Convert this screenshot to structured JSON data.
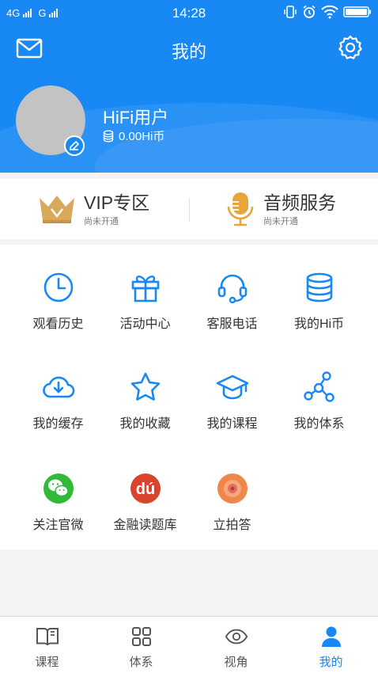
{
  "status_bar": {
    "network_1": "4G",
    "network_2": "G",
    "time": "14:28"
  },
  "header": {
    "title": "我的",
    "mail_icon": "mail-icon",
    "settings_icon": "gear-icon"
  },
  "profile": {
    "username": "HiFi用户",
    "coins": "0.00Hi币"
  },
  "services": [
    {
      "name": "VIP专区",
      "status": "尚未开通",
      "icon": "crown-icon"
    },
    {
      "name": "音频服务",
      "status": "尚未开通",
      "icon": "microphone-icon"
    }
  ],
  "grid": [
    {
      "label": "观看历史",
      "icon": "clock-icon"
    },
    {
      "label": "活动中心",
      "icon": "gift-icon"
    },
    {
      "label": "客服电话",
      "icon": "headset-icon"
    },
    {
      "label": "我的Hi币",
      "icon": "coins-stack-icon"
    },
    {
      "label": "我的缓存",
      "icon": "cloud-download-icon"
    },
    {
      "label": "我的收藏",
      "icon": "star-icon"
    },
    {
      "label": "我的课程",
      "icon": "graduation-cap-icon"
    },
    {
      "label": "我的体系",
      "icon": "network-nodes-icon"
    },
    {
      "label": "关注官微",
      "icon": "wechat-icon"
    },
    {
      "label": "金融读题库",
      "icon": "du-logo-icon"
    },
    {
      "label": "立拍答",
      "icon": "camera-lens-icon"
    }
  ],
  "tabs": [
    {
      "label": "课程",
      "icon": "book-icon",
      "active": false
    },
    {
      "label": "体系",
      "icon": "grid-icon",
      "active": false
    },
    {
      "label": "视角",
      "icon": "eye-icon",
      "active": false
    },
    {
      "label": "我的",
      "icon": "user-icon",
      "active": true
    }
  ],
  "colors": {
    "primary": "#1888F5",
    "vip_gold": "#D9A95B",
    "audio_orange": "#E8A53C",
    "wechat_green": "#33B93A",
    "du_red": "#D9452C",
    "lens_orange": "#F0874A"
  }
}
